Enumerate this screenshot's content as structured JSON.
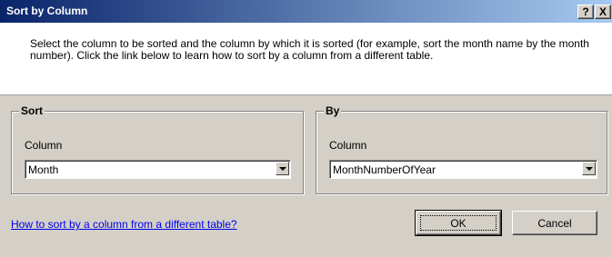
{
  "dialog": {
    "title": "Sort by Column",
    "help_label": "?",
    "close_label": "X"
  },
  "description": "Select the column to be sorted and the column by which it is sorted (for example, sort the month name by the month number). Click the link below to learn how to sort by a column from a different table.",
  "sort": {
    "legend": "Sort",
    "column_label": "Column",
    "column_value": "Month"
  },
  "by": {
    "legend": "By",
    "column_label": "Column",
    "column_value": "MonthNumberOfYear"
  },
  "link_text": "How to sort by a column from a different table?",
  "buttons": {
    "ok": "OK",
    "cancel": "Cancel"
  },
  "colors": {
    "title_gradient_start": "#0a246a",
    "title_gradient_end": "#a6caf0",
    "dialog_bg": "#d4d0c8",
    "link": "#0000ee"
  }
}
